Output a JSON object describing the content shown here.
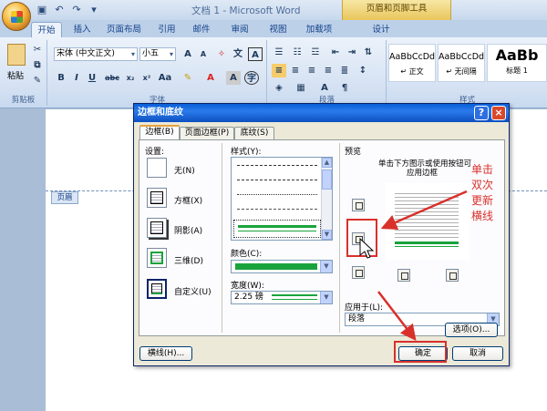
{
  "window": {
    "title": "文档 1 - Microsoft Word",
    "context_tool": "页眉和页脚工具"
  },
  "ribbon_tabs": [
    "开始",
    "插入",
    "页面布局",
    "引用",
    "邮件",
    "审阅",
    "视图",
    "加载项",
    "设计"
  ],
  "ribbon": {
    "paste_label": "粘贴",
    "clipboard_group": "剪贴板",
    "font_group": "字体",
    "paragraph_group": "段落",
    "styles_group": "样式",
    "font_name": "宋体 (中文正文)",
    "font_size": "小五",
    "styles": [
      {
        "sample": "AaBbCcDd",
        "name": "↵ 正文"
      },
      {
        "sample": "AaBbCcDd",
        "name": "↵ 无间隔"
      },
      {
        "sample": "AaBb",
        "name": "标题 1"
      }
    ]
  },
  "document": {
    "header_label": "页眉"
  },
  "dialog": {
    "title": "边框和底纹",
    "tabs": [
      "边框(B)",
      "页面边框(P)",
      "底纹(S)"
    ],
    "settings_label": "设置:",
    "settings": [
      "无(N)",
      "方框(X)",
      "阴影(A)",
      "三维(D)",
      "自定义(U)"
    ],
    "style_label": "样式(Y):",
    "color_label": "颜色(C):",
    "width_label": "宽度(W):",
    "width_value": "2.25 磅",
    "preview_label": "预览",
    "preview_hint_1": "单击下方图示或使用按钮可",
    "preview_hint_2": "应用边框",
    "apply_to_label": "应用于(L):",
    "apply_to_value": "段落",
    "options_button": "选项(O)...",
    "horizontal_line_button": "横线(H)...",
    "ok_button": "确定",
    "cancel_button": "取消",
    "accent_color": "#1aa33c"
  },
  "annotation": {
    "lines": [
      "单击",
      "双次",
      "更新",
      "横线"
    ],
    "color": "#d9302a"
  }
}
